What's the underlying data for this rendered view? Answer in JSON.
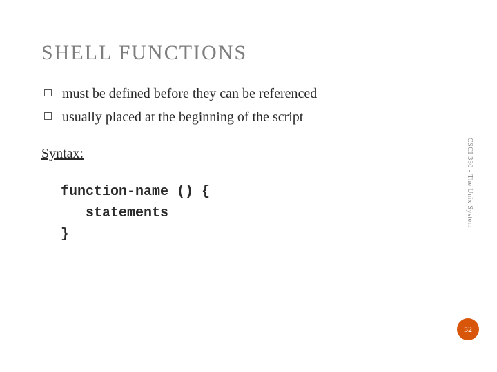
{
  "title": "SHELL FUNCTIONS",
  "bullets": [
    "must be defined before they can be referenced",
    "usually placed at the beginning of the script"
  ],
  "syntax_label": "Syntax:",
  "code_lines": [
    "function-name () {",
    "   statements",
    "}"
  ],
  "sidetext": "CSCI 330 - The Unix System",
  "page_number": "52",
  "colors": {
    "badge": "#d8560a",
    "title": "#7d7d7d"
  }
}
